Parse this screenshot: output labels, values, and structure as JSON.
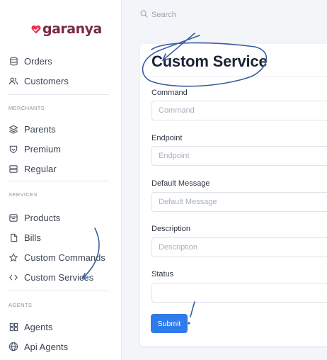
{
  "brand": {
    "name": "garanya",
    "accent": "#7a2a3f",
    "mark_color": "#e8344e"
  },
  "sidebar": {
    "items_top": [
      {
        "label": "Orders",
        "icon": "database-icon"
      },
      {
        "label": "Customers",
        "icon": "users-icon"
      }
    ],
    "sections": [
      {
        "title": "MERCHANTS",
        "items": [
          {
            "label": "Parents",
            "icon": "layers-icon"
          },
          {
            "label": "Premium",
            "icon": "shield-icon"
          },
          {
            "label": "Regular",
            "icon": "server-icon"
          }
        ]
      },
      {
        "title": "SERVICES",
        "items": [
          {
            "label": "Products",
            "icon": "box-icon"
          },
          {
            "label": "Bills",
            "icon": "file-icon"
          },
          {
            "label": "Custom Commands",
            "icon": "star-icon"
          },
          {
            "label": "Custom Services",
            "icon": "code-icon"
          }
        ]
      },
      {
        "title": "AGENTS",
        "items": [
          {
            "label": "Agents",
            "icon": "grid-icon"
          },
          {
            "label": "Api Agents",
            "icon": "globe-icon"
          }
        ]
      }
    ]
  },
  "search": {
    "placeholder": "Search"
  },
  "form": {
    "title": "Custom Service",
    "fields": [
      {
        "label": "Command",
        "placeholder": "Command"
      },
      {
        "label": "Endpoint",
        "placeholder": "Endpoint"
      },
      {
        "label": "Default Message",
        "placeholder": "Default Message"
      },
      {
        "label": "Description",
        "placeholder": "Description"
      },
      {
        "label": "Status",
        "placeholder": ""
      }
    ],
    "submit_label": "Submit"
  },
  "colors": {
    "primary": "#2f7bea",
    "annotation": "#3a5e9e"
  }
}
